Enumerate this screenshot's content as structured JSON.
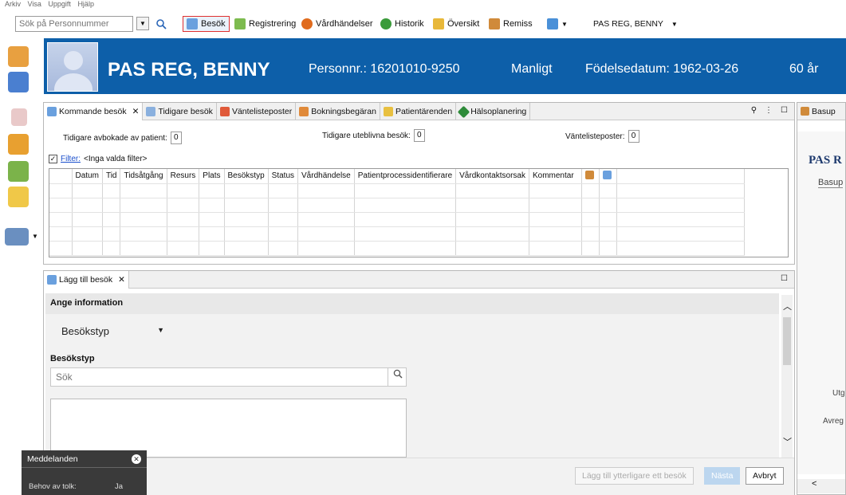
{
  "menubar": {
    "items": [
      "Arkiv",
      "Visa",
      "Uppgift",
      "Hjälp"
    ]
  },
  "toolbar": {
    "search_placeholder": "Sök på Personnummer",
    "items": [
      {
        "label": "Besök",
        "icon": "visit-icon"
      },
      {
        "label": "Registrering",
        "icon": "pen-icon"
      },
      {
        "label": "Vårdhändelser",
        "icon": "clock-icon"
      },
      {
        "label": "Historik",
        "icon": "history-icon"
      },
      {
        "label": "Översikt",
        "icon": "overview-icon"
      },
      {
        "label": "Remiss",
        "icon": "referral-icon"
      }
    ],
    "patient_selector": "PAS REG, BENNY"
  },
  "patient": {
    "name": "PAS REG, BENNY",
    "personnr": "Personnr.: 16201010-9250",
    "gender": "Manligt",
    "birthdate": "Födelsedatum: 1962-03-26",
    "age": "60 år"
  },
  "tabs": [
    "Kommande besök",
    "Tidigare besök",
    "Väntelisteposter",
    "Bokningsbegäran",
    "Patientärenden",
    "Hälsoplanering"
  ],
  "summary": {
    "cancelled_label": "Tidigare avbokade av patient:",
    "cancelled_value": "0",
    "noshow_label": "Tidigare uteblivna besök:",
    "noshow_value": "0",
    "waitlist_label": "Väntelisteposter:",
    "waitlist_value": "0"
  },
  "filter": {
    "link": "Filter:",
    "text": "<Inga valda filter>"
  },
  "table": {
    "columns": [
      "Datum",
      "Tid",
      "Tidsåtgång",
      "Resurs",
      "Plats",
      "Besökstyp",
      "Status",
      "Vårdhändelse",
      "Patientprocessidentifierare",
      "Vårdkontaktsorsak",
      "Kommentar"
    ]
  },
  "add_panel": {
    "tab": "Lägg till besök",
    "section": "Ange information",
    "dropdown": "Besökstyp",
    "field_label": "Besökstyp",
    "search_placeholder": "Sök",
    "btn_more": "Lägg till ytterligare ett besök",
    "btn_next": "Nästa",
    "btn_cancel": "Avbryt"
  },
  "right_panel": {
    "tab": "Basup",
    "title": "PAS R",
    "subtitle": "Basup",
    "label1": "Utg",
    "label2": "Avreg"
  },
  "messages": {
    "title": "Meddelanden",
    "row_label": "Behov av tolk:",
    "row_value": "Ja"
  }
}
